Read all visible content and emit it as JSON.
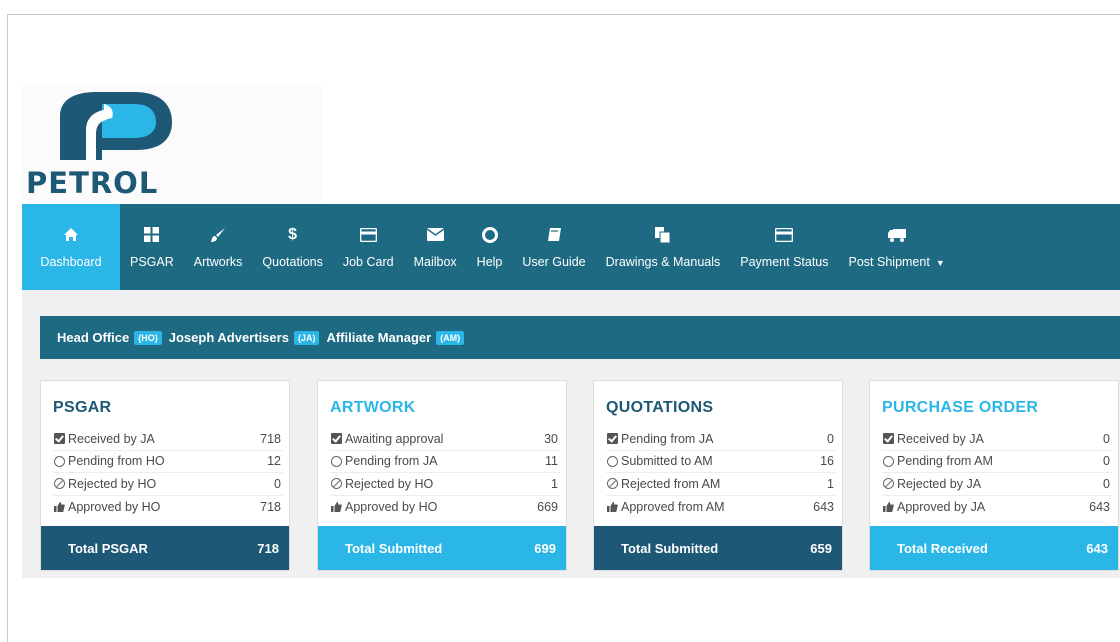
{
  "logo": {
    "text": "PETROL",
    "colors": {
      "dark": "#1d5876",
      "light": "#2ab6e6"
    }
  },
  "nav": {
    "items": [
      {
        "label": "Dashboard",
        "icon": "home-icon",
        "active": true
      },
      {
        "label": "PSGAR",
        "icon": "grid-icon"
      },
      {
        "label": "Artworks",
        "icon": "paintbrush-icon"
      },
      {
        "label": "Quotations",
        "icon": "dollar-icon"
      },
      {
        "label": "Job Card",
        "icon": "card-icon"
      },
      {
        "label": "Mailbox",
        "icon": "envelope-icon"
      },
      {
        "label": "Help",
        "icon": "lifebuoy-icon"
      },
      {
        "label": "User Guide",
        "icon": "book-icon"
      },
      {
        "label": "Drawings & Manuals",
        "icon": "copy-icon"
      },
      {
        "label": "Payment Status",
        "icon": "credit-card-icon"
      },
      {
        "label": "Post Shipment",
        "icon": "truck-icon",
        "dropdown": true
      }
    ]
  },
  "roles": [
    {
      "name": "Head Office",
      "tag": "(HO)"
    },
    {
      "name": "Joseph Advertisers",
      "tag": "(JA)"
    },
    {
      "name": "Affiliate Manager",
      "tag": "(AM)"
    }
  ],
  "cards": [
    {
      "title": "PSGAR",
      "title_color": "#1d5876",
      "footer_color": "#1d5876",
      "rows": [
        {
          "icon": "check-icon",
          "label": "Received by JA",
          "value": "718"
        },
        {
          "icon": "circle-icon",
          "label": "Pending from HO",
          "value": "12"
        },
        {
          "icon": "ban-icon",
          "label": "Rejected by HO",
          "value": "0"
        },
        {
          "icon": "thumbs-up-icon",
          "label": "Approved by HO",
          "value": "718"
        }
      ],
      "footer_label": "Total PSGAR",
      "footer_value": "718"
    },
    {
      "title": "ARTWORK",
      "title_color": "#2ab6e6",
      "footer_color": "#2ab6e6",
      "rows": [
        {
          "icon": "check-icon",
          "label": "Awaiting approval",
          "value": "30"
        },
        {
          "icon": "circle-icon",
          "label": "Pending from JA",
          "value": "11"
        },
        {
          "icon": "ban-icon",
          "label": "Rejected by HO",
          "value": "1"
        },
        {
          "icon": "thumbs-up-icon",
          "label": "Approved by HO",
          "value": "669"
        }
      ],
      "footer_label": "Total Submitted",
      "footer_value": "699"
    },
    {
      "title": "QUOTATIONS",
      "title_color": "#1d5876",
      "footer_color": "#1d5876",
      "rows": [
        {
          "icon": "check-icon",
          "label": "Pending from JA",
          "value": "0"
        },
        {
          "icon": "circle-icon",
          "label": "Submitted to AM",
          "value": "16"
        },
        {
          "icon": "ban-icon",
          "label": "Rejected from AM",
          "value": "1"
        },
        {
          "icon": "thumbs-up-icon",
          "label": "Approved from AM",
          "value": "643"
        }
      ],
      "footer_label": "Total Submitted",
      "footer_value": "659"
    },
    {
      "title": "PURCHASE ORDER",
      "title_color": "#2ab6e6",
      "footer_color": "#2ab6e6",
      "rows": [
        {
          "icon": "check-icon",
          "label": "Received by JA",
          "value": "0"
        },
        {
          "icon": "circle-icon",
          "label": "Pending from AM",
          "value": "0"
        },
        {
          "icon": "ban-icon",
          "label": "Rejected by JA",
          "value": "0"
        },
        {
          "icon": "thumbs-up-icon",
          "label": "Approved by JA",
          "value": "643"
        }
      ],
      "footer_label": "Total Received",
      "footer_value": "643"
    }
  ]
}
